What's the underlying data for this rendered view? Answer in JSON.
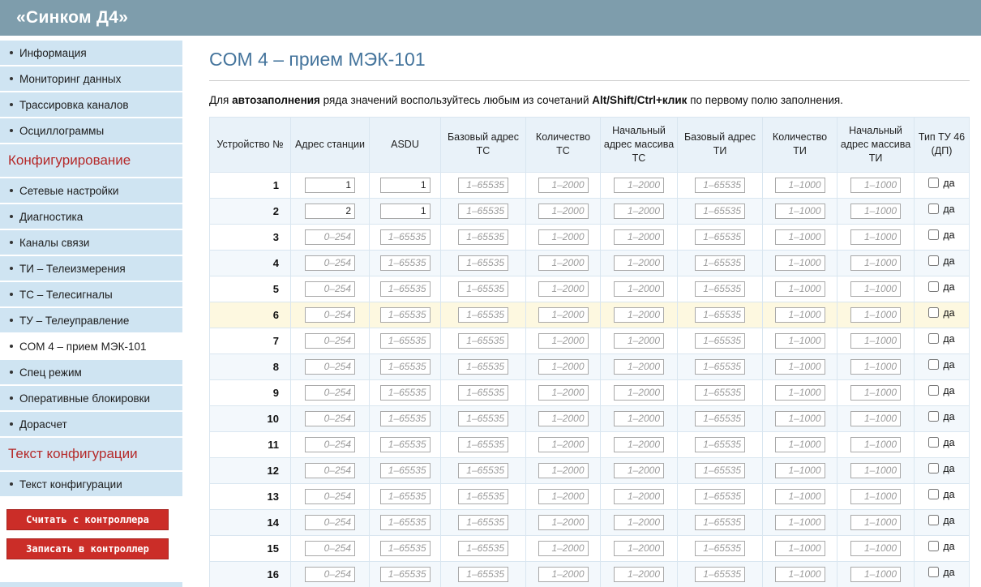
{
  "app": {
    "title": "«Синком Д4»"
  },
  "sidebar": {
    "items": [
      {
        "label": "Информация",
        "type": "item",
        "name": "sidebar-item-information"
      },
      {
        "label": "Мониторинг данных",
        "type": "item",
        "name": "sidebar-item-monitoring"
      },
      {
        "label": "Трассировка каналов",
        "type": "item",
        "name": "sidebar-item-channel-trace"
      },
      {
        "label": "Осциллограммы",
        "type": "item",
        "name": "sidebar-item-oscillograms"
      },
      {
        "label": "Конфигурирование",
        "type": "section",
        "name": "sidebar-section-configuration"
      },
      {
        "label": "Сетевые настройки",
        "type": "item",
        "name": "sidebar-item-network-settings"
      },
      {
        "label": "Диагностика",
        "type": "item",
        "name": "sidebar-item-diagnostics"
      },
      {
        "label": "Каналы связи",
        "type": "item",
        "name": "sidebar-item-comm-channels"
      },
      {
        "label": "ТИ – Телеизмерения",
        "type": "item",
        "name": "sidebar-item-ti-telemetry"
      },
      {
        "label": "ТС – Телесигналы",
        "type": "item",
        "name": "sidebar-item-ts-telesignals"
      },
      {
        "label": "ТУ – Телеуправление",
        "type": "item",
        "name": "sidebar-item-tu-telecontrol"
      },
      {
        "label": "COM 4 – прием МЭК-101",
        "type": "active",
        "name": "sidebar-item-com4-iec101"
      },
      {
        "label": "Спец режим",
        "type": "item",
        "name": "sidebar-item-special-mode"
      },
      {
        "label": "Оперативные блокировки",
        "type": "item",
        "name": "sidebar-item-operational-locks"
      },
      {
        "label": "Дорасчет",
        "type": "item",
        "name": "sidebar-item-recalculation"
      },
      {
        "label": "Текст конфигурации",
        "type": "section",
        "name": "sidebar-section-config-text"
      },
      {
        "label": "Текст конфигурации",
        "type": "item",
        "name": "sidebar-item-config-text"
      }
    ],
    "buttons": [
      {
        "label": "Считать с контроллера",
        "name": "read-from-controller-button"
      },
      {
        "label": "Записать в контроллер",
        "name": "write-to-controller-button"
      }
    ]
  },
  "main": {
    "title": "COM 4 – прием МЭК-101",
    "hint": {
      "part1": "Для ",
      "bold1": "автозаполнения",
      "part2": " ряда значений воспользуйтесь любым из сочетаний ",
      "bold2": "Alt/Shift/Ctrl+клик",
      "part3": " по первому полю заполнения."
    }
  },
  "table": {
    "columns": [
      "Устройство №",
      "Адрес станции",
      "ASDU",
      "Базовый адрес ТС",
      "Количество ТС",
      "Начальный адрес массива ТС",
      "Базовый адрес ТИ",
      "Количество ТИ",
      "Начальный адрес массива ТИ",
      "Тип ТУ 46 (ДП)"
    ],
    "field_names": [
      "station-address-input",
      "asdu-input",
      "ts-base-address-input",
      "ts-count-input",
      "ts-array-start-input",
      "ti-base-address-input",
      "ti-count-input",
      "ti-array-start-input"
    ],
    "placeholders": [
      "0–254",
      "1–65535",
      "1–65535",
      "1–2000",
      "1–2000",
      "1–65535",
      "1–1000",
      "1–1000"
    ],
    "checkbox_label": "да",
    "rows": [
      {
        "num": 1,
        "values": {
          "0": "1",
          "1": "1"
        }
      },
      {
        "num": 2,
        "values": {
          "0": "2",
          "1": "1"
        }
      },
      {
        "num": 3,
        "values": {}
      },
      {
        "num": 4,
        "values": {}
      },
      {
        "num": 5,
        "values": {}
      },
      {
        "num": 6,
        "values": {},
        "highlight": true
      },
      {
        "num": 7,
        "values": {}
      },
      {
        "num": 8,
        "values": {}
      },
      {
        "num": 9,
        "values": {}
      },
      {
        "num": 10,
        "values": {}
      },
      {
        "num": 11,
        "values": {}
      },
      {
        "num": 12,
        "values": {}
      },
      {
        "num": 13,
        "values": {}
      },
      {
        "num": 14,
        "values": {}
      },
      {
        "num": 15,
        "values": {}
      },
      {
        "num": 16,
        "values": {}
      }
    ]
  }
}
